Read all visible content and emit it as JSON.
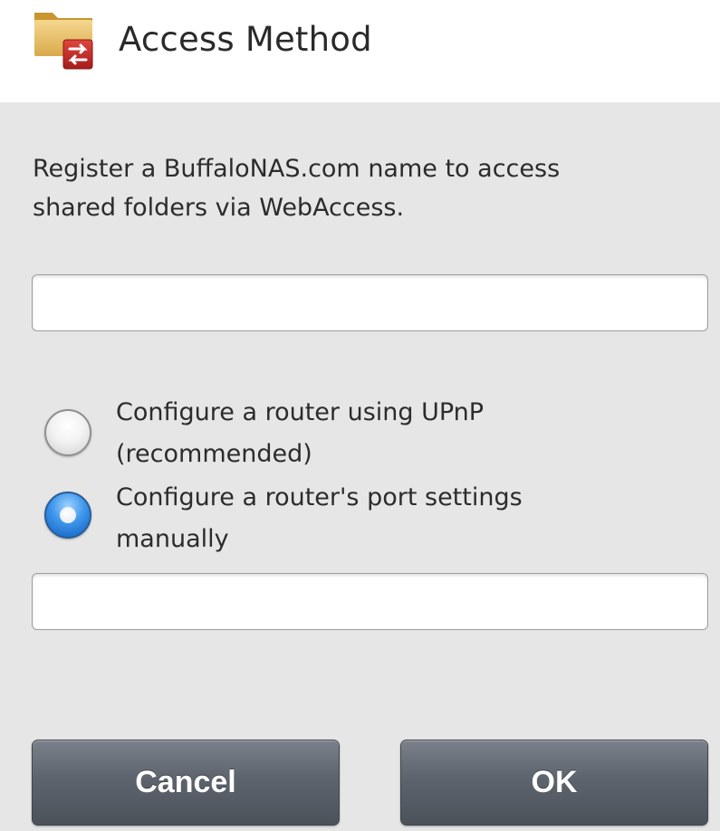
{
  "header": {
    "title": "Access Method",
    "icon": "folder-transfer-icon"
  },
  "body": {
    "description_lines": [
      "Register a BuffaloNAS.com name to access",
      "shared folders via WebAccess."
    ],
    "name_field": {
      "value": "",
      "placeholder": ""
    },
    "options": [
      {
        "label_lines": [
          "Configure a router using UPnP",
          "(recommended)"
        ],
        "selected": false
      },
      {
        "label_lines": [
          "Configure a router's port settings",
          "manually"
        ],
        "selected": true
      }
    ],
    "port_field": {
      "value": "",
      "placeholder": ""
    }
  },
  "buttons": {
    "cancel_label": "Cancel",
    "ok_label": "OK"
  },
  "colors": {
    "panel_bg": "#e6e6e6",
    "button_bg": "#5e646d",
    "radio_selected": "#3d95ea",
    "icon_folder": "#e8c26a",
    "icon_badge": "#c62828"
  }
}
